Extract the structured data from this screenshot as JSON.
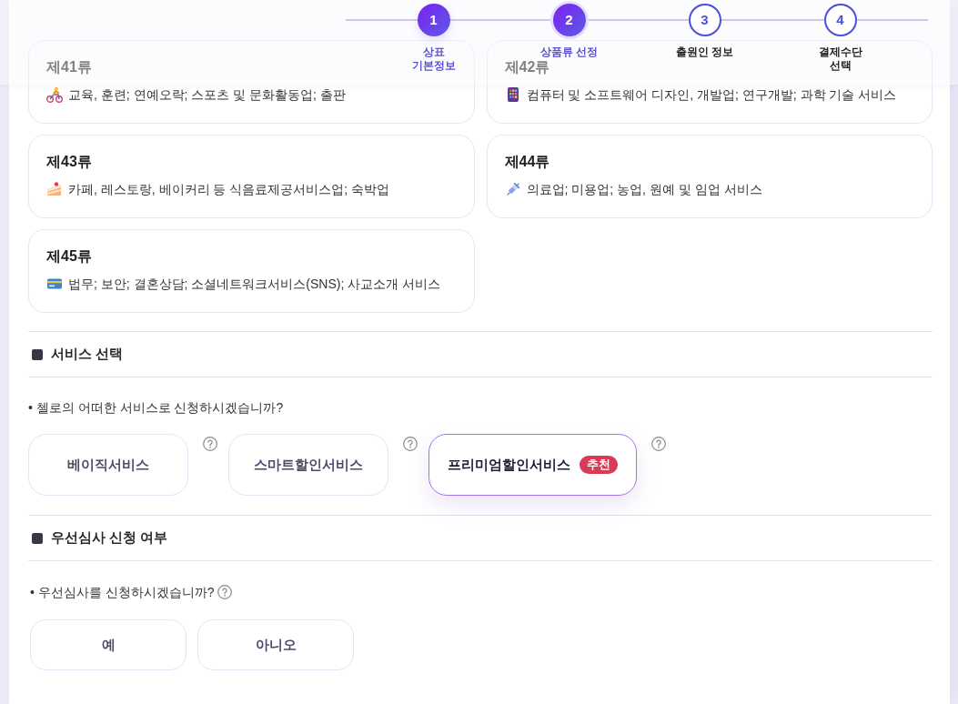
{
  "stepper": {
    "steps": [
      {
        "number": "1",
        "label": "상표 기본정보",
        "completed": true,
        "selected": false
      },
      {
        "number": "2",
        "label": "상품류 선정",
        "completed": false,
        "selected": true
      },
      {
        "number": "3",
        "label": "출원인 정보",
        "completed": false,
        "selected": false
      },
      {
        "number": "4",
        "label": "결제수단 선택",
        "completed": false,
        "selected": false
      }
    ]
  },
  "classes": [
    {
      "title": "제41류",
      "description": "교육, 훈련; 연예오락; 스포츠 및 문화활동업; 출판"
    },
    {
      "title": "제42류",
      "description": "컴퓨터 및 소프트웨어 디자인, 개발업; 연구개발; 과학 기술 서비스"
    },
    {
      "title": "제43류",
      "description": "카페, 레스토랑, 베이커리 등 식음료제공서비스업; 숙박업"
    },
    {
      "title": "제44류",
      "description": "의료업; 미용업; 농업, 원예 및 임업 서비스"
    },
    {
      "title": "제45류",
      "description": "법무; 보안; 결혼상담; 소셜네트워크서비스(SNS); 사교소개 서비스"
    }
  ],
  "service_section": {
    "heading": "서비스 선택",
    "question": "• 첼로의 어떠한 서비스로 신청하시겠습니까?",
    "options": [
      {
        "label": "베이직서비스",
        "selected": false
      },
      {
        "label": "스마트**할인**서비스",
        "selected": false
      },
      {
        "label": "프리미엄**할인**서비스",
        "selected": true,
        "badge": "추천"
      }
    ]
  },
  "priority_section": {
    "heading": "우선심사 신청 여부",
    "question": "• 우선심사를 신청하시겠습니까?",
    "options": [
      {
        "label": "예",
        "selected": false
      },
      {
        "label": "아니오",
        "selected": false
      }
    ]
  }
}
